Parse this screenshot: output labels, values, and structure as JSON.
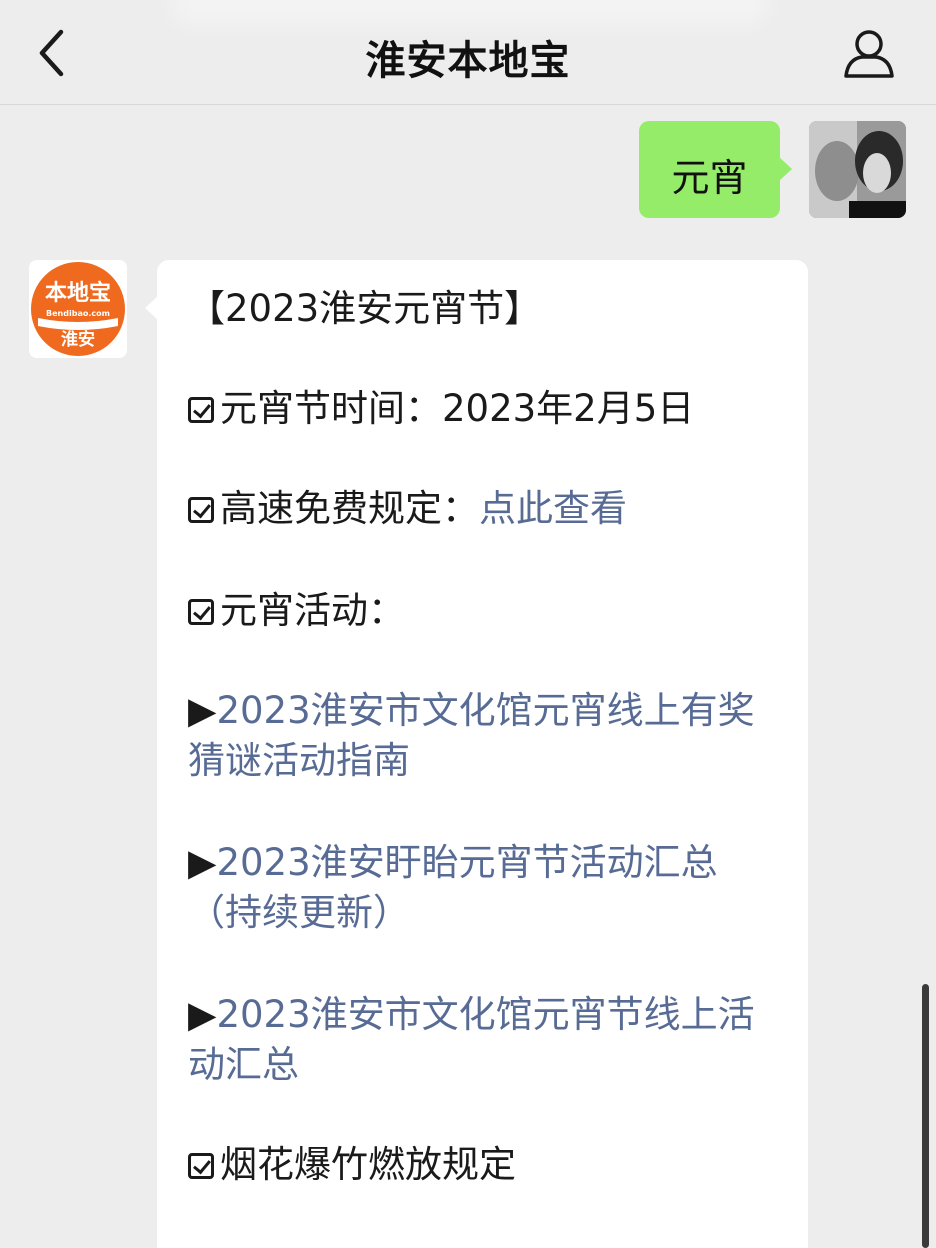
{
  "header": {
    "title": "淮安本地宝",
    "back_icon": "chevron-left-icon",
    "profile_icon": "user-icon"
  },
  "sent_message": {
    "text": "元宵",
    "bubble_color": "#95ec69"
  },
  "bot": {
    "logo_top": "本地宝",
    "logo_domain": "Bendibao.com",
    "logo_city": "淮安",
    "logo_color": "#ef6a1e"
  },
  "received_message": {
    "heading": "【2023淮安元宵节】",
    "date_label": "元宵节时间：",
    "date_value": "2023年2月5日",
    "highway_label": "高速免费规定：",
    "highway_link": "点此查看",
    "activities_label": "元宵活动：",
    "arrow_symbol": "▶",
    "activity_1": "2023淮安市文化馆元宵线上有奖猜谜活动指南",
    "activity_2": "2023淮安盱眙元宵节活动汇总（持续更新）",
    "activity_3": "2023淮安市文化馆元宵节线上活动汇总",
    "fireworks_label": "烟花爆竹燃放规定",
    "link_color": "#576b95"
  }
}
